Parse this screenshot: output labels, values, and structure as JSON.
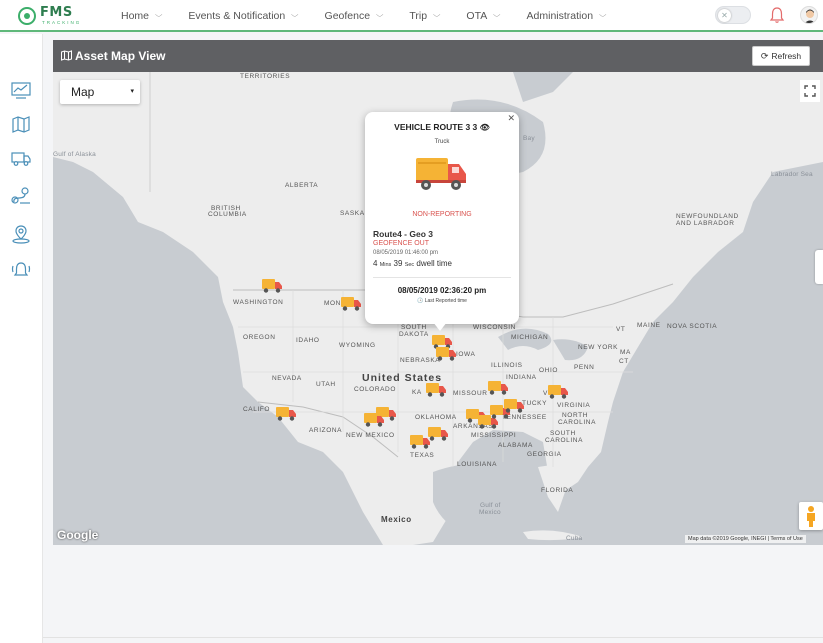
{
  "app": {
    "logo_text": "FMS",
    "logo_sub": "TRACKING"
  },
  "nav": {
    "items": [
      {
        "label": "Home"
      },
      {
        "label": "Events & Notification"
      },
      {
        "label": "Geofence"
      },
      {
        "label": "Trip"
      },
      {
        "label": "OTA"
      },
      {
        "label": "Administration"
      }
    ]
  },
  "sidebar": {
    "icons": [
      "dashboard-icon",
      "map-icon",
      "truck-icon",
      "route-icon",
      "location-pin-icon",
      "alarm-bell-icon"
    ]
  },
  "panel": {
    "title": "Asset Map View",
    "refresh_label": "Refresh"
  },
  "map": {
    "type_selected": "Map",
    "google_label": "Google",
    "attribution": "Map data ©2019 Google, INEGI  |  Terms of Use",
    "labels": {
      "territories": "TERRITORIES",
      "gulf_alaska": "Gulf of Alaska",
      "alberta": "ALBERTA",
      "british_columbia_1": "BRITISH",
      "british_columbia_2": "COLUMBIA",
      "saskatchewan": "SASKA",
      "hudson_bay": "Bay",
      "labrador_sea": "Labrador Sea",
      "newfoundland_1": "NEWFOUNDLAND",
      "newfoundland_2": "AND LABRADOR",
      "washington": "WASHINGTON",
      "montana": "MON",
      "oregon": "OREGON",
      "idaho": "IDAHO",
      "wyoming": "WYOMING",
      "south_dakota_1": "SOUTH",
      "south_dakota_2": "DAKOTA",
      "nebraska": "NEBRASKA",
      "iowa": "IOWA",
      "wisconsin": "WISCONSIN",
      "michigan": "MICHIGAN",
      "vt": "VT",
      "maine": "MAINE",
      "nova_scotia": "NOVA SCOTIA",
      "new_york": "NEW YORK",
      "ma": "MA",
      "ct": "CT",
      "penn": "PENN",
      "nevada": "NEVADA",
      "utah": "UTAH",
      "colorado": "COLORADO",
      "united_states": "United States",
      "kansas": "KA",
      "missouri": "MISSOUR",
      "illinois": "ILLINOIS",
      "indiana": "INDIANA",
      "ohio": "OHIO",
      "virginia": "VIRGINIA",
      "wv": "V",
      "kentucky": "TUCKY",
      "california": "CALIFO",
      "arizona": "ARIZONA",
      "new_mexico": "NEW MEXICO",
      "oklahoma": "OKLAHOMA",
      "tennessee": "TENNESSEE",
      "north_carolina_1": "NORTH",
      "north_carolina_2": "CAROLINA",
      "arkansas": "ARKANSAS",
      "south_carolina_1": "SOUTH",
      "south_carolina_2": "CAROLINA",
      "mississippi": "MISSISSIPPI",
      "alabama": "ALABAMA",
      "georgia": "GEORGIA",
      "texas": "TEXAS",
      "louisiana": "LOUISIANA",
      "florida": "FLORIDA",
      "gulf_mexico_1": "Gulf of",
      "gulf_mexico_2": "Mexico",
      "mexico": "Mexico",
      "cuba": "Cuba"
    }
  },
  "popup": {
    "title": "VEHICLE ROUTE 3 3",
    "vehicle_type": "Truck",
    "status": "NON-REPORTING",
    "route": "Route4 - Geo 3",
    "geofence_state": "GEOFENCE OUT",
    "event_time": "08/05/2019 01:46:00 pm",
    "dwell_mins": "4",
    "dwell_mins_unit": "Mins",
    "dwell_secs": "39",
    "dwell_secs_unit": "Sec",
    "dwell_suffix": "dwell time",
    "last_reported": "08/05/2019 02:36:20 pm",
    "last_reported_label": "Last Reported time"
  },
  "colors": {
    "accent": "#3cae6a",
    "header_bar": "#5f6063",
    "alert_red": "#d9534f",
    "truck_body": "#f5b335",
    "truck_cab": "#e8574a"
  }
}
